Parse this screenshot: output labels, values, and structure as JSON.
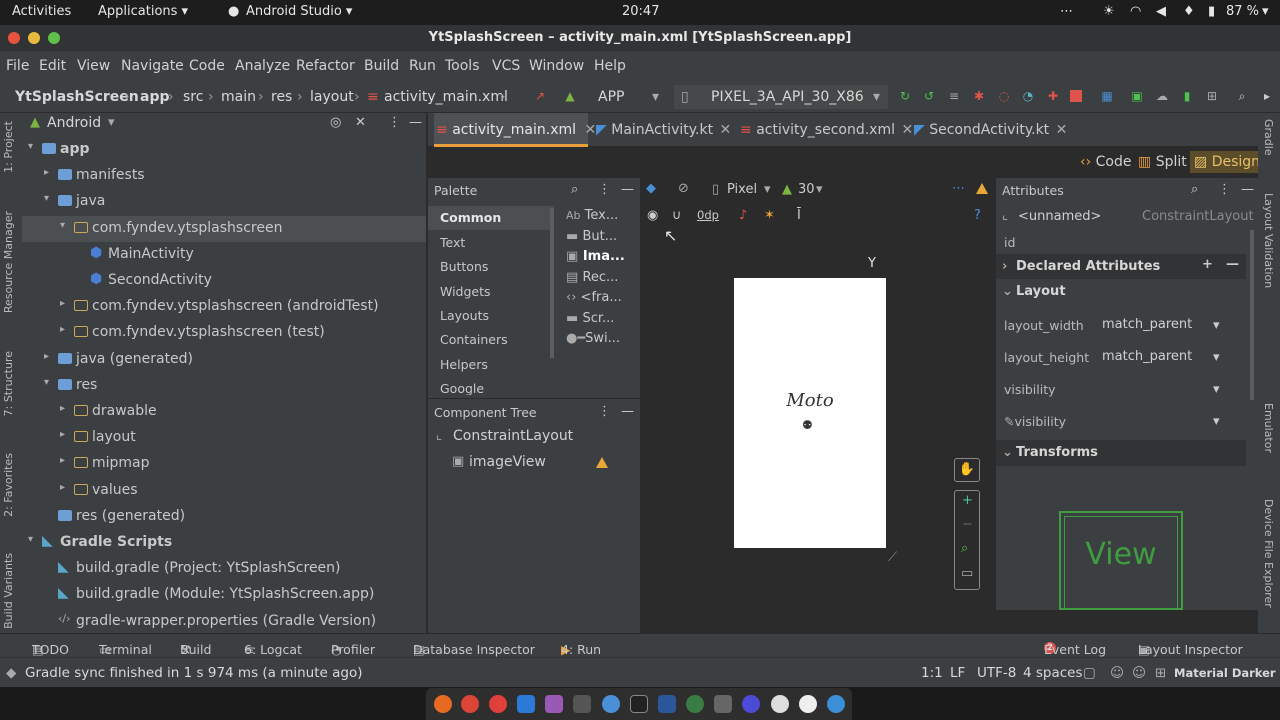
{
  "system": {
    "activities": "Activities",
    "applications": "Applications ▾",
    "app_name": "Android Studio ▾",
    "clock": "20:47",
    "battery": "87 %"
  },
  "window": {
    "title": "YtSplashScreen – activity_main.xml [YtSplashScreen.app]"
  },
  "menu": [
    "File",
    "Edit",
    "View",
    "Navigate",
    "Code",
    "Analyze",
    "Refactor",
    "Build",
    "Run",
    "Tools",
    "VCS",
    "Window",
    "Help"
  ],
  "breadcrumb": [
    "YtSplashScreen",
    "app",
    "src",
    "main",
    "res",
    "layout",
    "activity_main.xml"
  ],
  "toolbar": {
    "run_config": "APP",
    "device": "PIXEL_3A_API_30_X86"
  },
  "project": {
    "view_selector": "Android",
    "tree": [
      {
        "label": "app",
        "level": 0,
        "arrow": "▾",
        "icon": "folder"
      },
      {
        "label": "manifests",
        "level": 1,
        "arrow": "▸",
        "icon": "folder"
      },
      {
        "label": "java",
        "level": 1,
        "arrow": "▾",
        "icon": "folder"
      },
      {
        "label": "com.fyndev.ytsplashscreen",
        "level": 2,
        "arrow": "▾",
        "icon": "package"
      },
      {
        "label": "MainActivity",
        "level": 3,
        "arrow": "",
        "icon": "kotlin"
      },
      {
        "label": "SecondActivity",
        "level": 3,
        "arrow": "",
        "icon": "kotlin"
      },
      {
        "label": "com.fyndev.ytsplashscreen (androidTest)",
        "level": 2,
        "arrow": "▸",
        "icon": "package"
      },
      {
        "label": "com.fyndev.ytsplashscreen (test)",
        "level": 2,
        "arrow": "▸",
        "icon": "package"
      },
      {
        "label": "java (generated)",
        "level": 1,
        "arrow": "▸",
        "icon": "folder"
      },
      {
        "label": "res",
        "level": 1,
        "arrow": "▾",
        "icon": "folder"
      },
      {
        "label": "drawable",
        "level": 2,
        "arrow": "▸",
        "icon": "package"
      },
      {
        "label": "layout",
        "level": 2,
        "arrow": "▸",
        "icon": "package"
      },
      {
        "label": "mipmap",
        "level": 2,
        "arrow": "▸",
        "icon": "package"
      },
      {
        "label": "values",
        "level": 2,
        "arrow": "▸",
        "icon": "package"
      },
      {
        "label": "res (generated)",
        "level": 1,
        "arrow": "",
        "icon": "folder"
      },
      {
        "label": "Gradle Scripts",
        "level": 0,
        "arrow": "▾",
        "icon": "gradle"
      },
      {
        "label": "build.gradle (Project: YtSplashScreen)",
        "level": 1,
        "arrow": "",
        "icon": "gradle"
      },
      {
        "label": "build.gradle (Module: YtSplashScreen.app)",
        "level": 1,
        "arrow": "",
        "icon": "gradle"
      },
      {
        "label": "gradle-wrapper.properties (Gradle Version)",
        "level": 1,
        "arrow": "",
        "icon": "props"
      }
    ]
  },
  "left_strip": [
    "1: Project",
    "Resource Manager",
    "7: Structure",
    "2: Favorites",
    "Build Variants"
  ],
  "right_strip": [
    "Gradle",
    "Layout Validation",
    "Emulator",
    "Device File Explorer"
  ],
  "tabs": [
    "activity_main.xml",
    "MainActivity.kt",
    "activity_second.xml",
    "SecondActivity.kt"
  ],
  "modes": [
    "Code",
    "Split",
    "Design"
  ],
  "palette": {
    "title": "Palette",
    "categories": [
      "Common",
      "Text",
      "Buttons",
      "Widgets",
      "Layouts",
      "Containers",
      "Helpers",
      "Google"
    ],
    "items": [
      "Tex...",
      "But...",
      "Ima...",
      "Rec...",
      "<fra...",
      "Scr...",
      "Swi..."
    ]
  },
  "design_toolbar": {
    "device": "Pixel",
    "api": "30",
    "margin": "0dp"
  },
  "component_tree": {
    "title": "Component Tree",
    "root": "ConstraintLayout",
    "child": "imageView"
  },
  "canvas": {
    "logo_text": "Moto"
  },
  "attributes": {
    "title": "Attributes",
    "name": "<unnamed>",
    "type": "ConstraintLayout",
    "id_label": "id",
    "sections": {
      "declared": "Declared Attributes",
      "layout": "Layout",
      "transforms": "Transforms"
    },
    "rows": [
      {
        "label": "layout_width",
        "value": "match_parent"
      },
      {
        "label": "layout_height",
        "value": "match_parent"
      },
      {
        "label": "visibility",
        "value": ""
      },
      {
        "label": "visibility",
        "value": ""
      }
    ],
    "preview_text": "View"
  },
  "bottom_tools": [
    "TODO",
    "Terminal",
    "Build",
    "6: Logcat",
    "Profiler",
    "Database Inspector",
    "4: Run",
    "Event Log",
    "Layout Inspector"
  ],
  "event_count": "2",
  "status": {
    "message": "Gradle sync finished in 1 s 974 ms (a minute ago)",
    "position": "1:1",
    "line_sep": "LF",
    "encoding": "UTF-8",
    "indent": "4 spaces",
    "theme": "Material Darker"
  },
  "colors": {
    "accent": "#e79e3b",
    "bg": "#2b2b2b",
    "panel": "#3c3f41",
    "selection": "#4b6eaf"
  }
}
